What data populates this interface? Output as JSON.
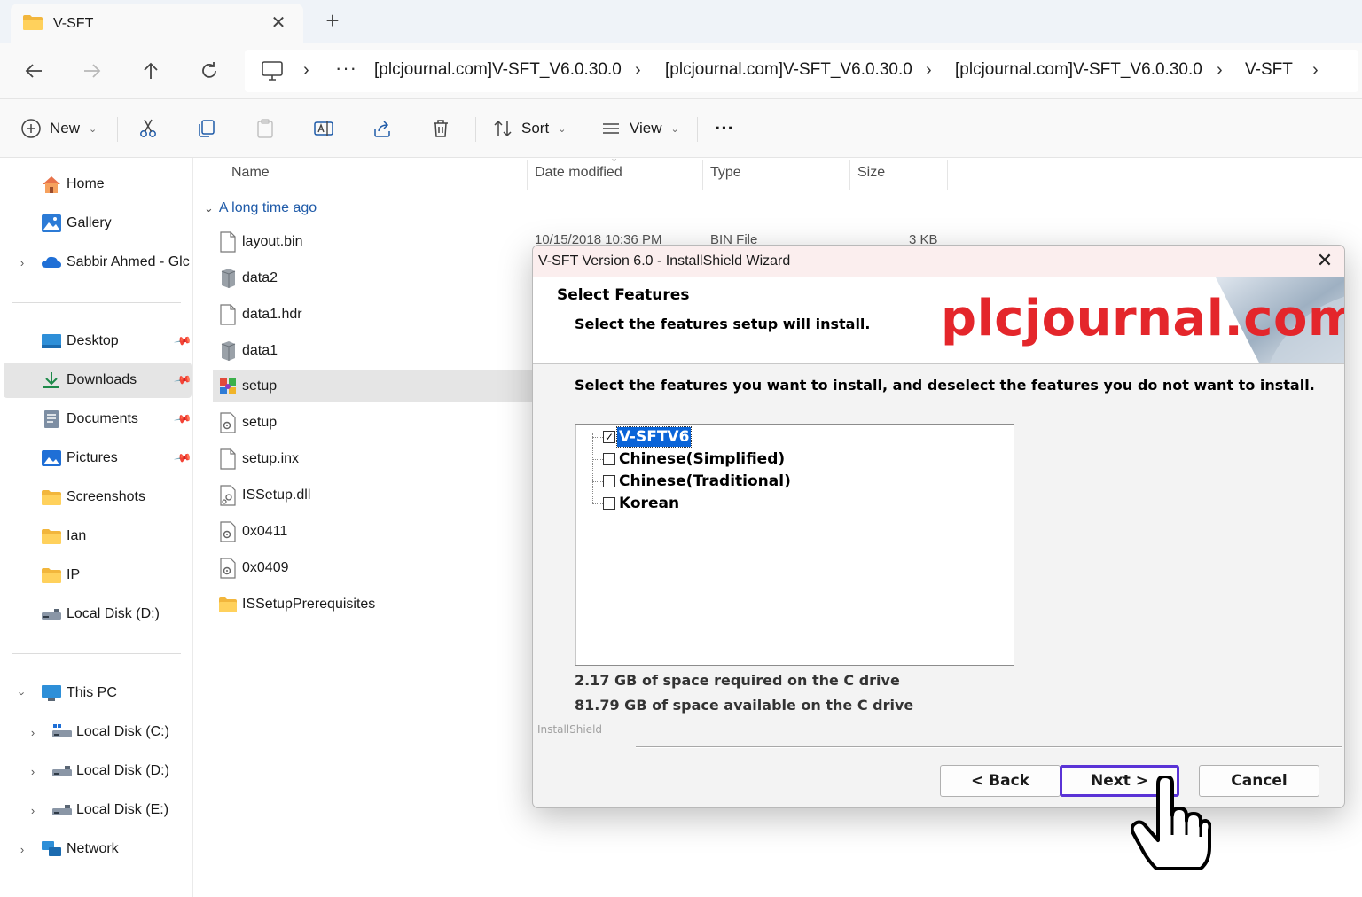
{
  "tab": {
    "title": "V-SFT",
    "close_glyph": "✕",
    "new_glyph": "+"
  },
  "address": {
    "overflow": "···",
    "crumbs": [
      "[plcjournal.com]V-SFT_V6.0.30.0",
      "[plcjournal.com]V-SFT_V6.0.30.0",
      "[plcjournal.com]V-SFT_V6.0.30.0",
      "V-SFT"
    ],
    "separator": "›"
  },
  "toolbar": {
    "new_label": "New",
    "sort_label": "Sort",
    "view_label": "View",
    "more_glyph": "···"
  },
  "sidebar": {
    "home": "Home",
    "gallery": "Gallery",
    "onedrive": "Sabbir Ahmed - Glc",
    "pinned": [
      {
        "label": "Desktop",
        "icon": "desktop-icon",
        "pinned": true
      },
      {
        "label": "Downloads",
        "icon": "download-icon",
        "pinned": true
      },
      {
        "label": "Documents",
        "icon": "documents-icon",
        "pinned": true
      },
      {
        "label": "Pictures",
        "icon": "pictures-icon",
        "pinned": true
      },
      {
        "label": "Screenshots",
        "icon": "folder-icon",
        "pinned": false
      },
      {
        "label": "Ian",
        "icon": "folder-icon",
        "pinned": false
      },
      {
        "label": "IP",
        "icon": "folder-icon",
        "pinned": false
      },
      {
        "label": "Local Disk (D:)",
        "icon": "drive-icon",
        "pinned": false
      }
    ],
    "this_pc": "This PC",
    "drives": [
      "Local Disk (C:)",
      "Local Disk (D:)",
      "Local Disk (E:)"
    ],
    "network": "Network"
  },
  "columns": {
    "name": "Name",
    "date": "Date modified",
    "type": "Type",
    "size": "Size"
  },
  "group": {
    "label": "A long time ago",
    "chevron": "⌵"
  },
  "files": [
    {
      "name": "layout.bin",
      "icon": "file-icon"
    },
    {
      "name": "data2",
      "icon": "archive-icon"
    },
    {
      "name": "data1.hdr",
      "icon": "file-icon"
    },
    {
      "name": "data1",
      "icon": "archive-icon"
    },
    {
      "name": "setup",
      "icon": "installer-icon"
    },
    {
      "name": "setup",
      "icon": "config-icon"
    },
    {
      "name": "setup.inx",
      "icon": "file-icon"
    },
    {
      "name": "ISSetup.dll",
      "icon": "dll-icon"
    },
    {
      "name": "0x0411",
      "icon": "config-icon"
    },
    {
      "name": "0x0409",
      "icon": "config-icon"
    },
    {
      "name": "ISSetupPrerequisites",
      "icon": "folder-icon"
    }
  ],
  "first_row_meta": {
    "date": "10/15/2018 10:36 PM",
    "type": "BIN File",
    "size": "3 KB"
  },
  "dialog": {
    "title": "V-SFT Version 6.0 - InstallShield Wizard",
    "close_glyph": "✕",
    "heading": "Select Features",
    "subheading": "Select the features setup will install.",
    "watermark": "plcjournal.com",
    "instruction": "Select the features you want to install, and deselect the features you do not want to install.",
    "features": [
      {
        "label": "V-SFTV6",
        "checked": true,
        "highlighted": true
      },
      {
        "label": "Chinese(Simplified)",
        "checked": false,
        "highlighted": false
      },
      {
        "label": "Chinese(Traditional)",
        "checked": false,
        "highlighted": false
      },
      {
        "label": "Korean",
        "checked": false,
        "highlighted": false
      }
    ],
    "space_required": "2.17 GB of space required on the C drive",
    "space_available": "81.79 GB of space available on the C drive",
    "brand": "InstallShield",
    "back_label": "< Back",
    "next_label": "Next >",
    "cancel_label": "Cancel",
    "accent_color": "#5a33d6"
  }
}
